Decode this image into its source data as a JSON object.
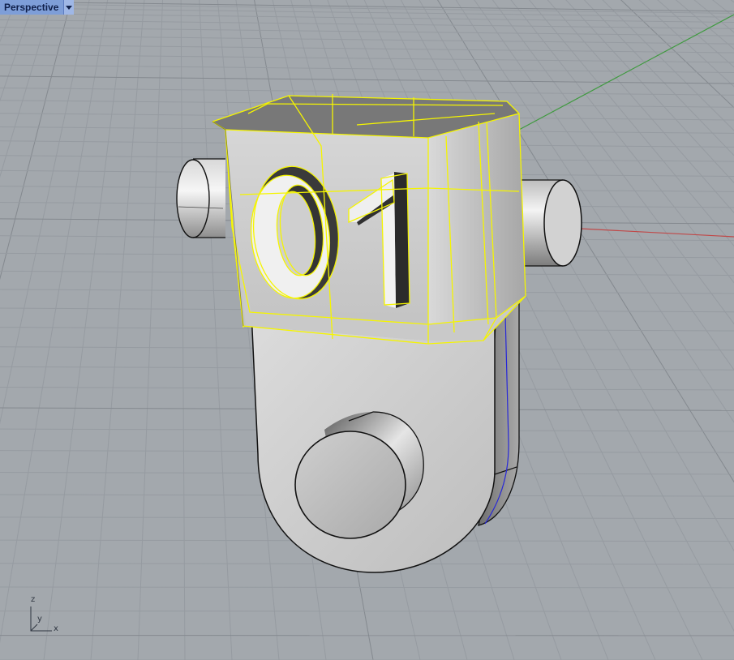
{
  "viewport": {
    "title": "Perspective",
    "axis_labels": {
      "z": "z",
      "y": "y",
      "x": "x"
    },
    "colors": {
      "background": "#a3a8ad",
      "grid_minor": "#969ba1",
      "grid_major": "#84898f",
      "x_axis": "#c04848",
      "y_axis": "#3f9a3f",
      "selection": "#f5f500"
    }
  },
  "model": {
    "engraved_text": "01",
    "selected": true
  }
}
